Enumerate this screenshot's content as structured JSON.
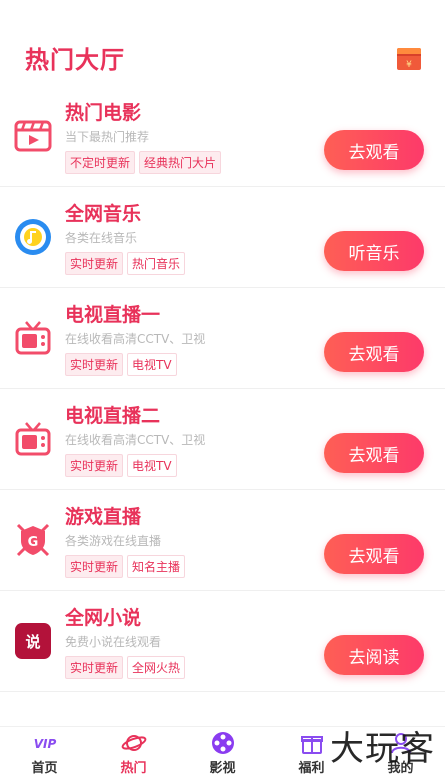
{
  "header": {
    "title": "热门大厅",
    "gift_icon": "red-envelope-icon"
  },
  "items": [
    {
      "title": "热门电影",
      "desc": "当下最热门推荐",
      "tags": [
        "不定时更新",
        "经典热门大片"
      ],
      "action": "去观看",
      "icon": "film-clapper-icon"
    },
    {
      "title": "全网音乐",
      "desc": "各类在线音乐",
      "tags": [
        "实时更新",
        "热门音乐"
      ],
      "action": "听音乐",
      "icon": "music-disc-icon"
    },
    {
      "title": "电视直播一",
      "desc": "在线收看高清CCTV、卫视",
      "tags": [
        "实时更新",
        "电视TV"
      ],
      "action": "去观看",
      "icon": "tv-icon"
    },
    {
      "title": "电视直播二",
      "desc": "在线收看高清CCTV、卫视",
      "tags": [
        "实时更新",
        "电视TV"
      ],
      "action": "去观看",
      "icon": "tv-icon"
    },
    {
      "title": "游戏直播",
      "desc": "各类游戏在线直播",
      "tags": [
        "实时更新",
        "知名主播"
      ],
      "action": "去观看",
      "icon": "game-shield-icon"
    },
    {
      "title": "全网小说",
      "desc": "免费小说在线观看",
      "tags": [
        "实时更新",
        "全网火热"
      ],
      "action": "去阅读",
      "icon": "novel-book-icon",
      "icon_text": "说"
    }
  ],
  "tabs": [
    {
      "label": "首页",
      "icon": "vip-icon",
      "icon_text": "VIP"
    },
    {
      "label": "热门",
      "icon": "planet-icon",
      "active": true
    },
    {
      "label": "影视",
      "icon": "film-reel-icon"
    },
    {
      "label": "福利",
      "icon": "gift-box-icon"
    },
    {
      "label": "我的",
      "icon": "user-icon"
    }
  ],
  "watermark": "大玩客",
  "colors": {
    "accent": "#e8325a",
    "button_start": "#fe5f55",
    "button_end": "#fd3a6a",
    "tag_bg": "#fdecef"
  }
}
